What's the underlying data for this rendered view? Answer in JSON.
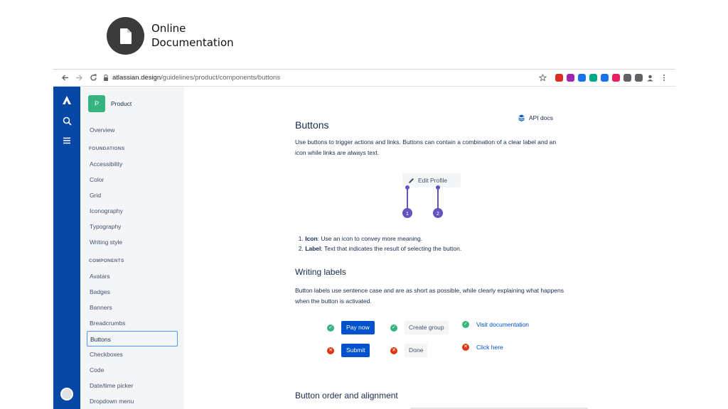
{
  "slide": {
    "title_line1": "Online",
    "title_line2": "Documentation",
    "badge_icon": "document-icon"
  },
  "browser": {
    "url_domain": "atlassian.design",
    "url_path": "/guidelines/product/components/buttons",
    "extension_colors": [
      "#d93025",
      "#9c27b0",
      "#1a73e8",
      "#00a884",
      "#1a73e8",
      "#e91e63",
      "#5f6368",
      "#5f6368"
    ]
  },
  "sidebar": {
    "product_initial": "P",
    "product_name": "Product",
    "overview": "Overview",
    "foundations_heading": "FOUNDATIONS",
    "foundations": [
      "Accessibility",
      "Color",
      "Grid",
      "Iconography",
      "Typography",
      "Writing style"
    ],
    "components_heading": "COMPONENTS",
    "components": [
      "Avatars",
      "Badges",
      "Banners",
      "Breadcrumbs",
      "Buttons",
      "Checkboxes",
      "Code",
      "Date/time picker",
      "Dropdown menu"
    ],
    "selected": "Buttons"
  },
  "content": {
    "title": "Buttons",
    "api_docs": "API docs",
    "intro": "Use buttons to trigger actions and links. Buttons can contain a combination of a clear label and an icon while links are always text.",
    "demo_button": "Edit Profile",
    "callout_1": "1",
    "callout_2": "2",
    "list_1_term": "Icon",
    "list_1_text": ": Use an icon to convey more meaning.",
    "list_2_term": "Label",
    "list_2_text": ": Text that indicates the result of selecting the button.",
    "writing_labels_heading": "Writing labels",
    "writing_labels_text": "Button labels use sentence case and are as short as possible, while clearly explaining what happens when the button is activated.",
    "good_examples": [
      "Pay now",
      "Create group",
      "Visit documentation"
    ],
    "bad_examples": [
      "Submit",
      "Done",
      "Click here"
    ],
    "order_heading": "Button order and alignment"
  },
  "colors": {
    "brand_blue": "#0747a6",
    "primary_button": "#0052cc",
    "callout_purple": "#6554c0",
    "success_green": "#36b37e",
    "error_red": "#de350b"
  }
}
